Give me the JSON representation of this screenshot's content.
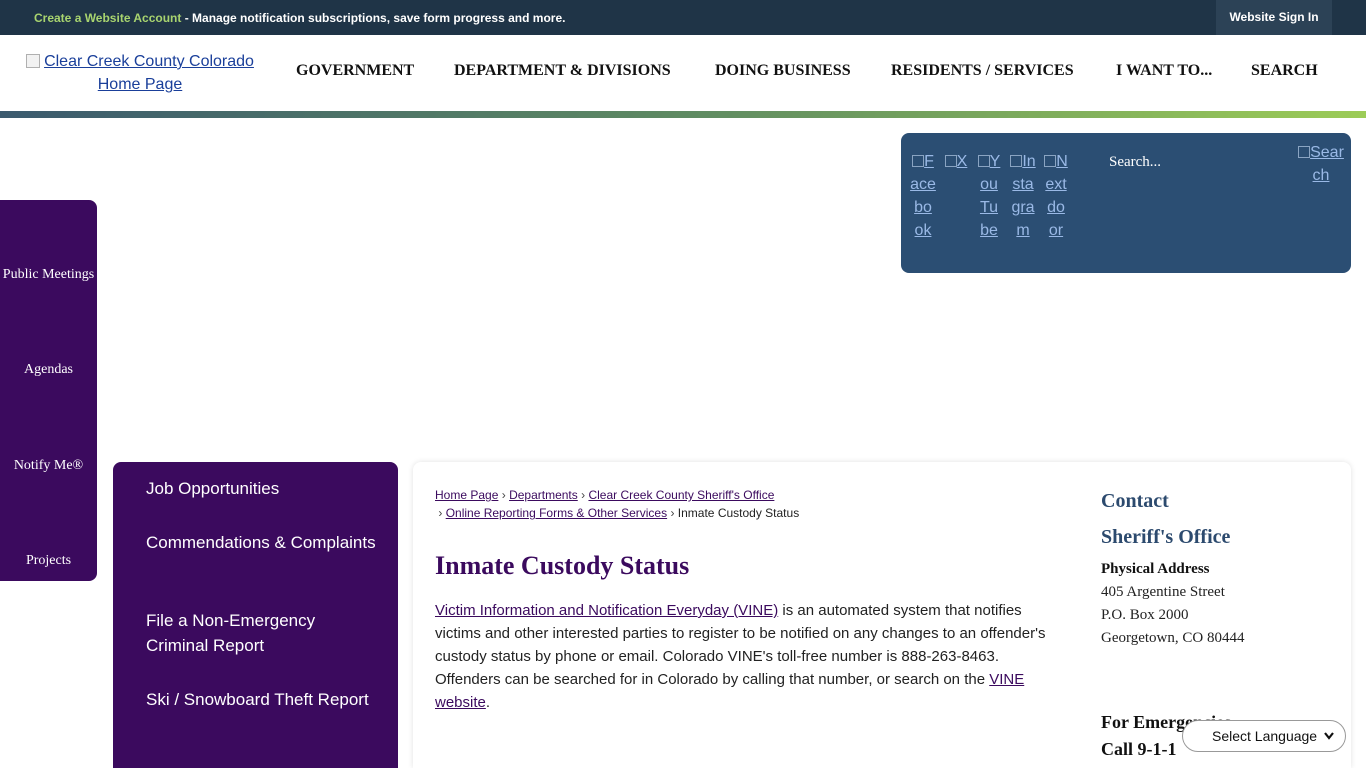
{
  "topbar": {
    "create_link": "Create a Website Account",
    "message": " - Manage notification subscriptions, save form progress and more.",
    "sign_in": "Website Sign In"
  },
  "header": {
    "logo_alt": "Clear Creek County Colorado Home Page",
    "nav": [
      "GOVERNMENT",
      "DEPARTMENT & DIVISIONS",
      "DOING BUSINESS",
      "RESIDENTS / SERVICES",
      "I WANT TO...",
      "SEARCH"
    ]
  },
  "social": {
    "links": [
      "Facebook",
      "X",
      "YouTube",
      "Instagram",
      "Nextdoor"
    ],
    "search_placeholder": "Search...",
    "search_button": "Search"
  },
  "quick_links": [
    "Public Meetings",
    "Agendas",
    "Notify Me®",
    "Projects"
  ],
  "side_menu": [
    "Job Opportunities",
    "Commendations & Complaints",
    "File a Non-Emergency Criminal Report",
    "Ski / Snowboard Theft Report"
  ],
  "breadcrumb": {
    "items": [
      "Home Page",
      "Departments",
      "Clear Creek County Sheriff's Office",
      "Online Reporting Forms & Other Services"
    ],
    "current": "Inmate Custody Status"
  },
  "page": {
    "title": "Inmate Custody Status",
    "vine_link": "Victim Information and Notification Everyday (VINE)",
    "body_text": " is an automated system that notifies victims and other interested parties to register to be notified on any changes to an offender's custody status by phone or email. Colorado VINE's toll-free number is 888-263-8463. Offenders can be searched for in Colorado by calling that number, or search on the ",
    "website_link": "VINE website",
    "end": "."
  },
  "contact": {
    "heading": "Contact",
    "office": "Sheriff's Office",
    "address_label": "Physical Address",
    "address_lines": [
      "405 Argentine Street",
      "P.O. Box 2000",
      "Georgetown, CO 80444"
    ],
    "emergency_heading": "For Emergencies",
    "emergency_call": "Call 9-1-1"
  },
  "language": {
    "label": "Select Language"
  }
}
